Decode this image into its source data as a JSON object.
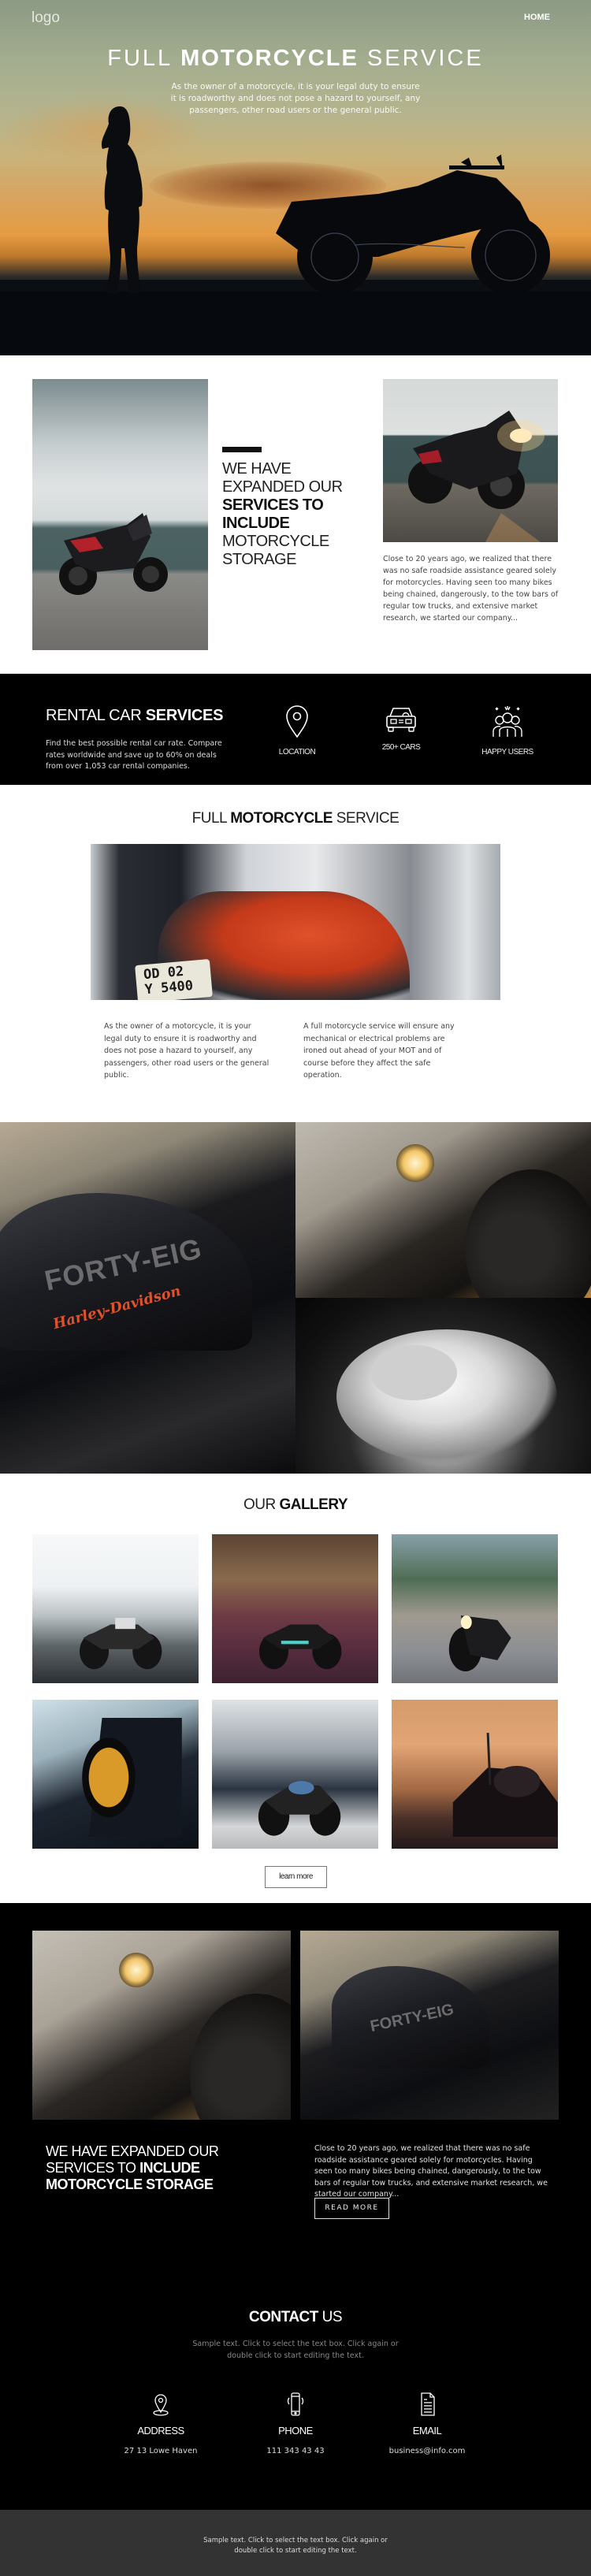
{
  "header": {
    "logo": "logo",
    "nav": [
      {
        "label": "HOME"
      }
    ]
  },
  "hero": {
    "title_light_1": "FULL ",
    "title_bold": "MOTORCYCLE",
    "title_light_2": " SERVICE",
    "subtitle": "As the owner of a motorcycle, it is your legal duty to ensure it is roadworthy and does not pose a hazard to yourself, any passengers, other road users or the general public."
  },
  "storage": {
    "title_light_1": "WE HAVE EXPANDED OUR ",
    "title_bold": "SERVICES TO INCLUDE",
    "title_light_2": " MOTORCYCLE STORAGE",
    "text": "Close to 20 years ago, we realized that there was no safe roadside assistance geared solely for motorcycles. Having seen too many bikes being chained, dangerously, to the tow bars of regular tow trucks, and extensive market research, we started our company..."
  },
  "rental": {
    "title_light": "RENTAL CAR ",
    "title_bold": "SERVICES",
    "text": "Find the best possible rental car rate. Compare rates worldwide and save up to 60% on deals from over 1,053 car rental companies.",
    "features": [
      {
        "icon": "location-pin-icon",
        "label": "LOCATION"
      },
      {
        "icon": "car-icon",
        "label": "250+ CARS"
      },
      {
        "icon": "happy-users-icon",
        "label": "HAPPY USERS"
      }
    ]
  },
  "service": {
    "title_light_1": "FULL ",
    "title_bold": "MOTORCYCLE",
    "title_light_2": " SERVICE",
    "plate_line1": "OD 02",
    "plate_line2": "Y 5400",
    "col1": "As the owner of a motorcycle, it is your legal duty to ensure it is roadworthy and does not pose a hazard to yourself, any passengers, other road users or the general public.",
    "col2": "A full motorcycle service will ensure any mechanical or electrical problems are ironed out ahead of your MOT and of course before they affect the safe operation."
  },
  "collage": {
    "tank_text": "FORTY-EIG",
    "tank_script": "Harley-Davidson"
  },
  "gallery": {
    "title_light": "OUR ",
    "title_bold": "GALLERY",
    "items": [
      {
        "alt": "man-with-cafe-racer"
      },
      {
        "alt": "motorcycle-night-street"
      },
      {
        "alt": "motorcycle-headlight-front"
      },
      {
        "alt": "bmw-headlight-closeup"
      },
      {
        "alt": "blue-scrambler"
      },
      {
        "alt": "cruiser-at-sunset"
      }
    ],
    "button_label": "learn more"
  },
  "dark": {
    "title_light_1": "WE HAVE EXPANDED OUR SERVICES TO ",
    "title_bold": "INCLUDE MOTORCYCLE STORAGE",
    "text": "Close to 20 years ago, we realized that there was no safe roadside assistance geared solely for motorcycles. Having seen too many bikes being chained, dangerously, to the tow bars of regular tow trucks, and extensive market research, we started our company...",
    "button_label": "READ MORE",
    "tank_text": "FORTY-EIG"
  },
  "contact": {
    "title_bold": "CONTACT",
    "title_light": " US",
    "subtitle": "Sample text. Click to select the text box. Click again or double click to start editing the text.",
    "items": [
      {
        "icon": "map-pin-icon",
        "label": "ADDRESS",
        "value": "27 13 Lowe Haven"
      },
      {
        "icon": "smartphone-icon",
        "label": "PHONE",
        "value": "111 343 43 43"
      },
      {
        "icon": "document-icon",
        "label": "EMAIL",
        "value": "business@info.com"
      }
    ]
  },
  "footer": {
    "text": "Sample text. Click to select the text box. Click again or double click to start editing the text."
  }
}
